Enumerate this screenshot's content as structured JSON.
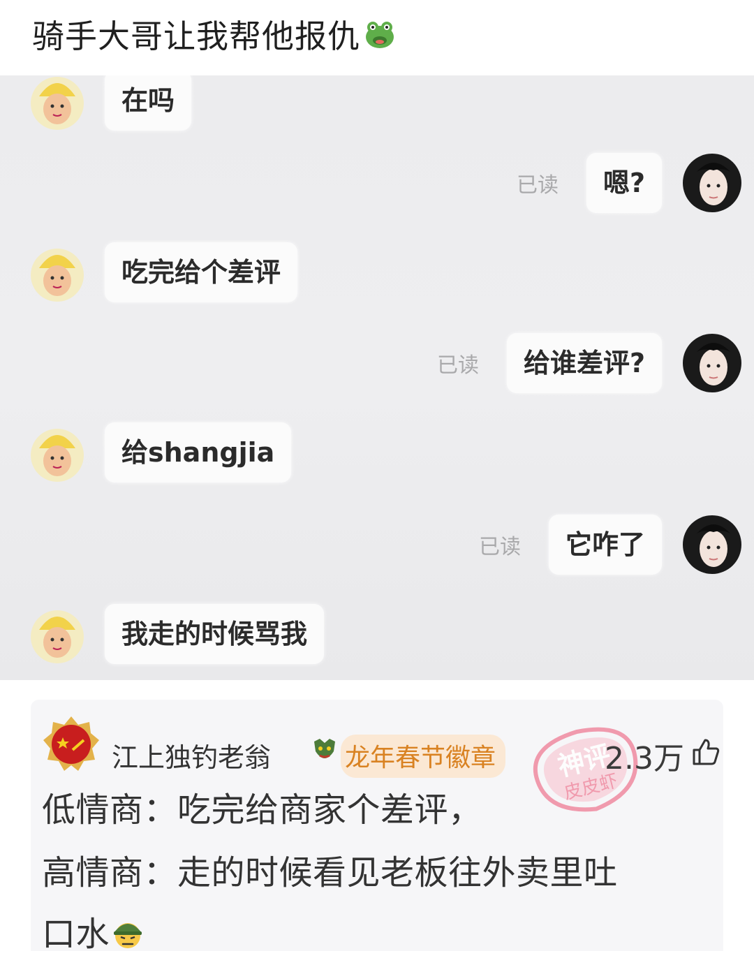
{
  "post": {
    "title": "骑手大哥让我帮他报仇",
    "title_emoji": "frog-face-icon"
  },
  "chat": {
    "messages": [
      {
        "side": "left",
        "text": "在吗"
      },
      {
        "side": "right",
        "text": "嗯?",
        "status": "已读"
      },
      {
        "side": "left",
        "text": "吃完给个差评"
      },
      {
        "side": "right",
        "text": "给谁差评?",
        "status": "已读"
      },
      {
        "side": "left",
        "text": "给shangjia"
      },
      {
        "side": "right",
        "text": "它咋了",
        "status": "已读"
      },
      {
        "side": "left",
        "text": "我走的时候骂我"
      }
    ]
  },
  "comment": {
    "user_name": "江上独钓老翁",
    "badge_label": "龙年春节徽章",
    "stamp_top": "神评",
    "stamp_bottom": "皮皮虾",
    "like_count": "2.3万",
    "lines": [
      "低情商：吃完给商家个差评，",
      "高情商：走的时候看见老板往外卖里吐",
      "口水"
    ],
    "end_emoji": "soldier-face-icon"
  },
  "colors": {
    "badge_text": "#d98222",
    "badge_bg": "#fbe8d4",
    "stamp": "#f08aa0"
  }
}
